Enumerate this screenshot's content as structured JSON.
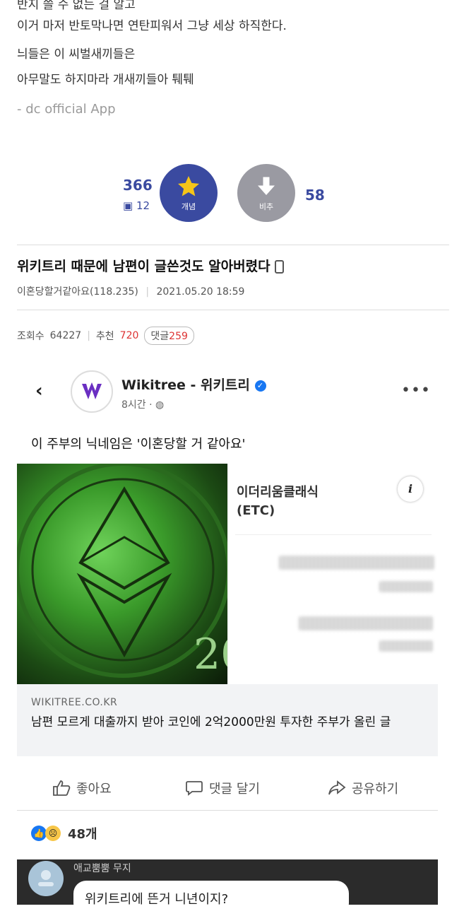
{
  "post": {
    "top_partial": "반지 쓸 수 없는 걸 알고",
    "lines": [
      "이거 마저 반토막나면 연탄피워서 그냥 세상 하직한다.",
      "늬들은 이 씨벌새끼들은",
      "아무말도 하지마라 개새끼들아 퉤퉤"
    ],
    "app_tag": "- dc official App"
  },
  "votes": {
    "up_count": "366",
    "fixed_count": "12",
    "up_label": "개념",
    "down_label": "비추",
    "down_count": "58"
  },
  "article": {
    "title": "위키트리 때문에 남편이 글쓴것도 알아버렸다",
    "author": "이혼당할거같아요(118.235)",
    "date": "2021.05.20 18:59",
    "views_label": "조회수",
    "views": "64227",
    "recommend_label": "추천",
    "recommend": "720",
    "comments_label": "댓글",
    "comments": "259"
  },
  "fb": {
    "page_name": "Wikitree - 위키트리",
    "time": "8시간 ·",
    "caption": "이 주부의 닉네임은 '이혼당할 거 같아요'",
    "coin_title": "이더리움클래식",
    "coin_ticker": "(ETC)",
    "info": "i",
    "domain": "WIKITREE.CO.KR",
    "headline": "남편 모르게 대출까지 받아 코인에 2억2000만원 투자한 주부가 올린 글",
    "like": "좋아요",
    "comment": "댓글 달기",
    "share": "공유하기",
    "reaction_count": "48개",
    "commenter": "애교뿜뿜 무지",
    "comment_text": "위키트리에 뜬거 니년이지?"
  },
  "colors": {
    "accent": "#3a4aa0",
    "down_gray": "#9a9aa2",
    "star": "#f5c518"
  }
}
